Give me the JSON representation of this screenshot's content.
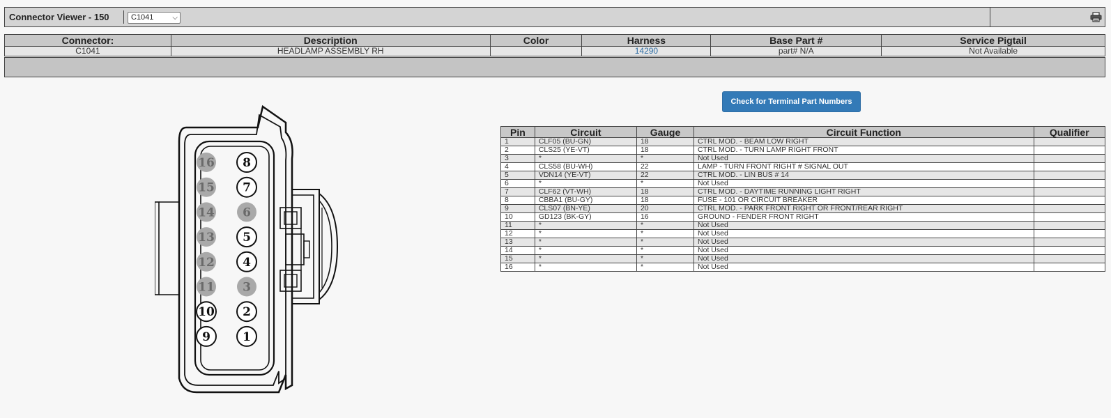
{
  "titlebar": {
    "title": "Connector Viewer - 150",
    "selected_connector": "C1041",
    "print_icon": "printer-icon"
  },
  "info": {
    "headers": [
      "Connector:",
      "Description",
      "Color",
      "Harness",
      "Base Part #",
      "Service Pigtail"
    ],
    "connector": "C1041",
    "description": "HEADLAMP ASSEMBLY RH",
    "color": "",
    "harness": "14290",
    "base_part": "part# N/A",
    "service_pigtail": "Not Available"
  },
  "check_button_label": "Check for Terminal Part Numbers",
  "pins": {
    "headers": [
      "Pin",
      "Circuit",
      "Gauge",
      "Circuit Function",
      "Qualifier"
    ],
    "rows": [
      {
        "pin": "1",
        "circuit": "CLF05 (BU-GN)",
        "gauge": "18",
        "function": "CTRL MOD. - BEAM LOW RIGHT",
        "qualifier": ""
      },
      {
        "pin": "2",
        "circuit": "CLS25 (YE-VT)",
        "gauge": "18",
        "function": "CTRL MOD. - TURN LAMP RIGHT FRONT",
        "qualifier": ""
      },
      {
        "pin": "3",
        "circuit": "*",
        "gauge": "*",
        "function": "Not Used",
        "qualifier": ""
      },
      {
        "pin": "4",
        "circuit": "CLS58 (BU-WH)",
        "gauge": "22",
        "function": "LAMP - TURN FRONT RIGHT # SIGNAL OUT",
        "qualifier": ""
      },
      {
        "pin": "5",
        "circuit": "VDN14 (YE-VT)",
        "gauge": "22",
        "function": "CTRL MOD. - LIN BUS # 14",
        "qualifier": ""
      },
      {
        "pin": "6",
        "circuit": "*",
        "gauge": "*",
        "function": "Not Used",
        "qualifier": ""
      },
      {
        "pin": "7",
        "circuit": "CLF62 (VT-WH)",
        "gauge": "18",
        "function": "CTRL MOD. - DAYTIME RUNNING LIGHT RIGHT",
        "qualifier": ""
      },
      {
        "pin": "8",
        "circuit": "CBBA1 (BU-GY)",
        "gauge": "18",
        "function": "FUSE - 101 OR CIRCUIT BREAKER",
        "qualifier": ""
      },
      {
        "pin": "9",
        "circuit": "CLS07 (BN-YE)",
        "gauge": "20",
        "function": "CTRL MOD. - PARK FRONT RIGHT OR FRONT/REAR RIGHT",
        "qualifier": ""
      },
      {
        "pin": "10",
        "circuit": "GD123 (BK-GY)",
        "gauge": "16",
        "function": "GROUND - FENDER FRONT RIGHT",
        "qualifier": ""
      },
      {
        "pin": "11",
        "circuit": "*",
        "gauge": "*",
        "function": "Not Used",
        "qualifier": ""
      },
      {
        "pin": "12",
        "circuit": "*",
        "gauge": "*",
        "function": "Not Used",
        "qualifier": ""
      },
      {
        "pin": "13",
        "circuit": "*",
        "gauge": "*",
        "function": "Not Used",
        "qualifier": ""
      },
      {
        "pin": "14",
        "circuit": "*",
        "gauge": "*",
        "function": "Not Used",
        "qualifier": ""
      },
      {
        "pin": "15",
        "circuit": "*",
        "gauge": "*",
        "function": "Not Used",
        "qualifier": ""
      },
      {
        "pin": "16",
        "circuit": "*",
        "gauge": "*",
        "function": "Not Used",
        "qualifier": ""
      }
    ]
  },
  "diagram": {
    "left_column_pins": [
      "16",
      "15",
      "14",
      "13",
      "12",
      "11",
      "10",
      "9"
    ],
    "right_column_pins": [
      "8",
      "7",
      "6",
      "5",
      "4",
      "3",
      "2",
      "1"
    ],
    "unused_pins": [
      "3",
      "6",
      "11",
      "12",
      "13",
      "14",
      "15",
      "16"
    ],
    "colors": {
      "used_fill": "#ffffff",
      "unused_fill": "#a9a9a9",
      "unused_text": "#6a6a6a",
      "button": "#337ab7",
      "link": "#2e6da4"
    }
  }
}
